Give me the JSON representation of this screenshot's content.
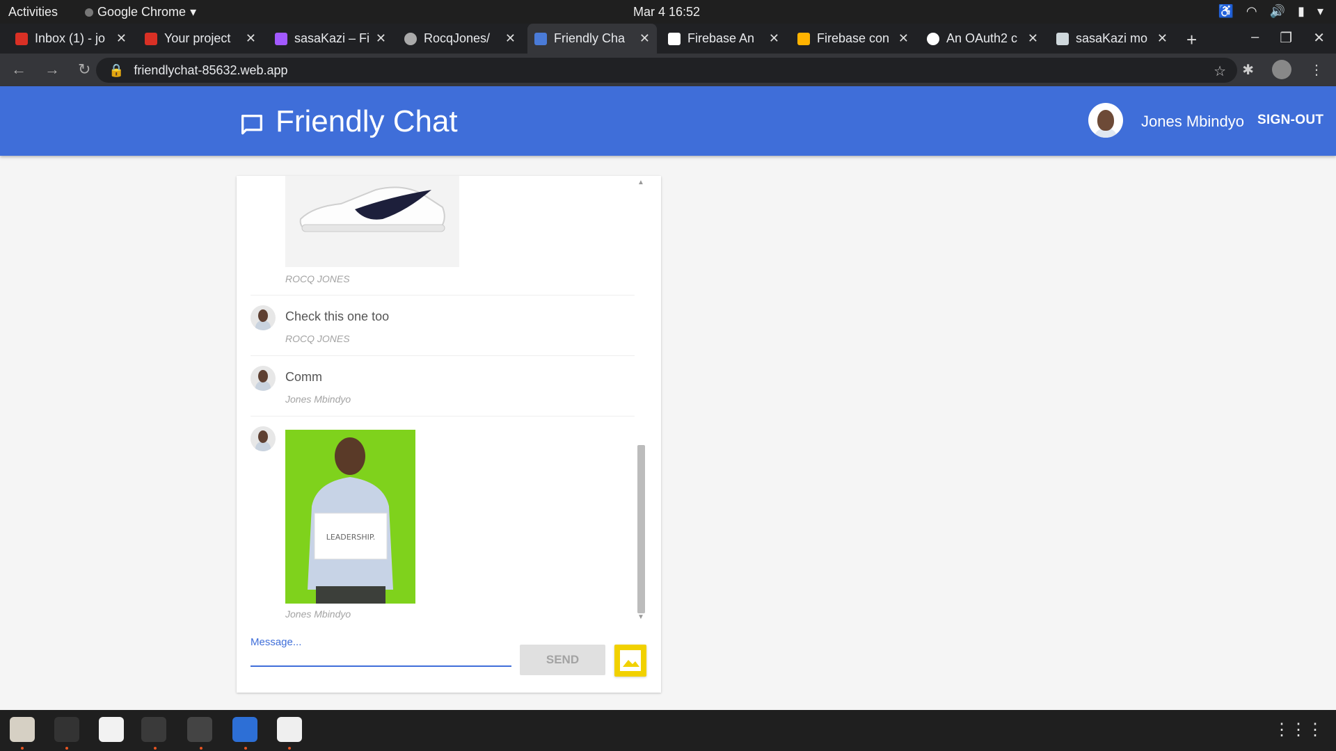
{
  "system": {
    "activities": "Activities",
    "app_name": "Google Chrome",
    "clock": "Mar 4  16:52"
  },
  "tabs": [
    {
      "title": "Inbox (1) - jo",
      "favicon": "gmail-icon",
      "color": "#d93025"
    },
    {
      "title": "Your project",
      "favicon": "gmail-icon",
      "color": "#d93025"
    },
    {
      "title": "sasaKazi – Fi",
      "favicon": "figma-icon",
      "color": "#a259ff"
    },
    {
      "title": "RocqJones/",
      "favicon": "github-icon",
      "color": "#aaaaaa"
    },
    {
      "title": "Friendly Cha",
      "favicon": "chat-icon",
      "color": "#4a7bd8"
    },
    {
      "title": "Firebase An",
      "favicon": "android-studio-icon",
      "color": "#ffffff"
    },
    {
      "title": "Firebase con",
      "favicon": "firebase-icon",
      "color": "#ffb300"
    },
    {
      "title": "An OAuth2 c",
      "favicon": "google-icon",
      "color": "#ffffff"
    },
    {
      "title": "sasaKazi mo",
      "favicon": "trello-icon",
      "color": "#cfd8dc"
    }
  ],
  "browser": {
    "url": "friendlychat-85632.web.app"
  },
  "header": {
    "title": "Friendly Chat",
    "user_name": "Jones Mbindyo",
    "sign_out": "SIGN-OUT",
    "bg_color": "#3f6ed9"
  },
  "messages": [
    {
      "type": "image",
      "image": "sneaker-photo",
      "author": "ROCQ JONES"
    },
    {
      "type": "text",
      "text": "Check this one too",
      "author": "ROCQ JONES"
    },
    {
      "type": "text",
      "text": "Comm",
      "author": "Jones Mbindyo"
    },
    {
      "type": "image",
      "image": "person-photo",
      "image_caption": "LEADERSHIP.",
      "author": "Jones Mbindyo"
    }
  ],
  "composer": {
    "placeholder": "Message...",
    "send_label": "SEND",
    "image_button_color": "#f1d100"
  }
}
